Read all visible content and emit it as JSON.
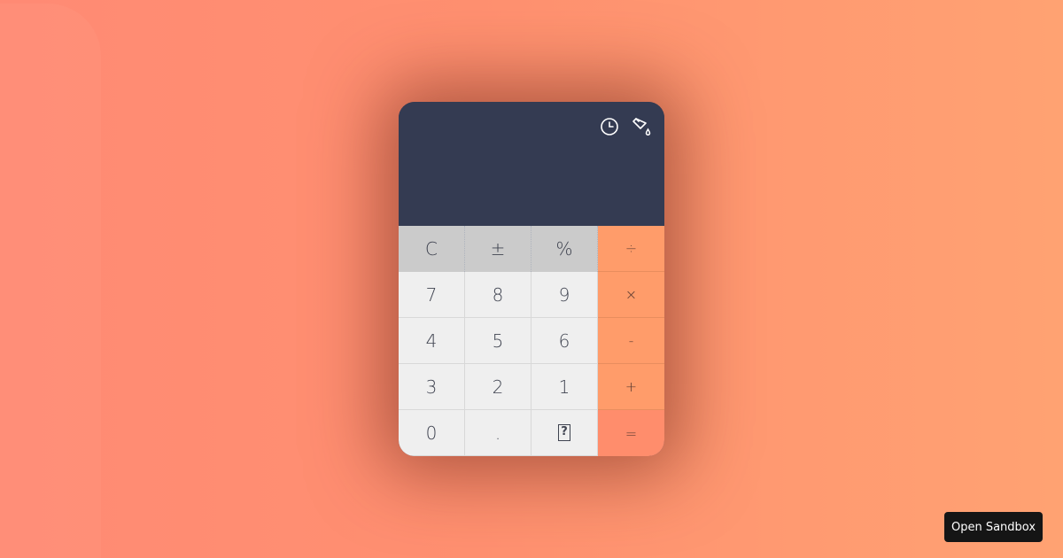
{
  "display": {
    "value": ""
  },
  "icons": {
    "history": "clock-icon",
    "theme": "paint-bucket-icon"
  },
  "keys": {
    "clear": "C",
    "plus_minus": "±",
    "percent": "%",
    "divide": "÷",
    "seven": "7",
    "eight": "8",
    "nine": "9",
    "multiply": "×",
    "four": "4",
    "five": "5",
    "six": "6",
    "subtract": "-",
    "three": "3",
    "two": "2",
    "one": "1",
    "add": "+",
    "zero": "0",
    "decimal": ".",
    "unknown": "?",
    "equals": "="
  },
  "sandbox": {
    "label": "Open Sandbox"
  },
  "colors": {
    "display_bg": "#343b52",
    "function_key_bg": "#cbcbcb",
    "number_key_bg": "#efefef",
    "operator_key_bg": "#ff9c6a",
    "equals_key_bg": "#ff8d6c",
    "sandbox_button_bg": "#151515"
  }
}
